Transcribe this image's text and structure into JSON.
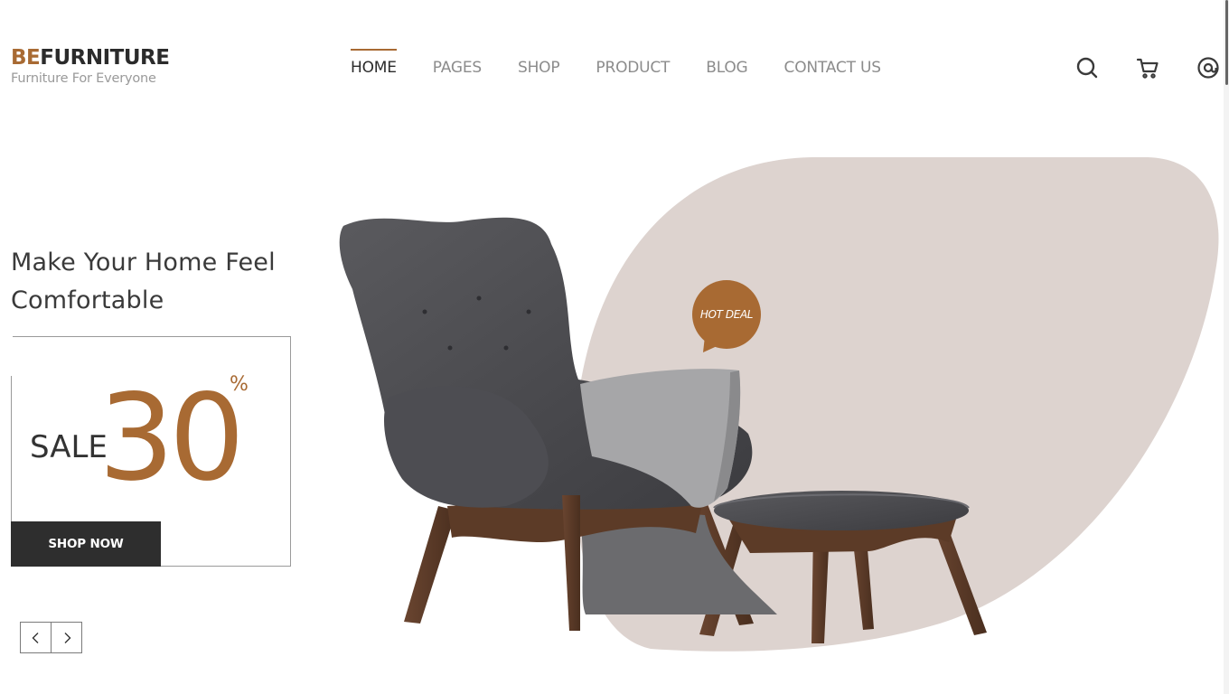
{
  "brand": {
    "prefix": "BE",
    "name": "FURNITURE",
    "tagline": "Furniture For Everyone",
    "accent_color": "#a86a33"
  },
  "nav": {
    "items": [
      {
        "label": "HOME",
        "active": true
      },
      {
        "label": "PAGES",
        "active": false
      },
      {
        "label": "SHOP",
        "active": false
      },
      {
        "label": "PRODUCT",
        "active": false
      },
      {
        "label": "BLOG",
        "active": false
      },
      {
        "label": "CONTACT US",
        "active": false
      }
    ]
  },
  "header_icons": [
    "search-icon",
    "cart-icon",
    "user-account-icon"
  ],
  "hero": {
    "title_line1": "Make Your Home Feel",
    "title_line2": "Comfortable",
    "sale_word": "SALE",
    "sale_number": "30",
    "sale_percent": "%",
    "cta_label": "SHOP NOW",
    "badge_label": "HOT DEAL",
    "blob_color": "#ddd3cf",
    "chair_color": "#4a4a4e",
    "wood_color": "#5a3a26"
  },
  "slider_controls": [
    "chevron-left-icon",
    "chevron-right-icon"
  ]
}
